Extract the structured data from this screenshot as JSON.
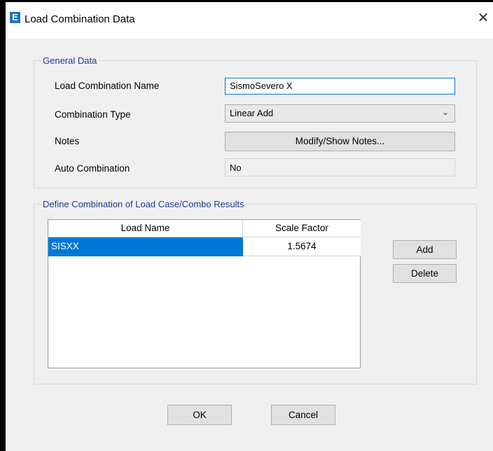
{
  "window": {
    "title": "Load Combination Data",
    "app_icon_letter": "E",
    "close_glyph": "✕"
  },
  "general": {
    "legend": "General Data",
    "name_label": "Load Combination Name",
    "name_value": "SismoSevero X",
    "type_label": "Combination Type",
    "type_value": "Linear Add",
    "notes_label": "Notes",
    "notes_button": "Modify/Show Notes...",
    "auto_label": "Auto Combination",
    "auto_value": "No"
  },
  "define": {
    "legend": "Define Combination of Load Case/Combo Results",
    "columns": [
      "Load Name",
      "Scale Factor"
    ],
    "rows": [
      {
        "load_name": "SISXX",
        "scale_factor": "1.5674"
      }
    ],
    "add_button": "Add",
    "delete_button": "Delete"
  },
  "footer": {
    "ok_button": "OK",
    "cancel_button": "Cancel"
  },
  "colors": {
    "selection": "#0078d7",
    "legend_text": "#1b3d8f"
  }
}
